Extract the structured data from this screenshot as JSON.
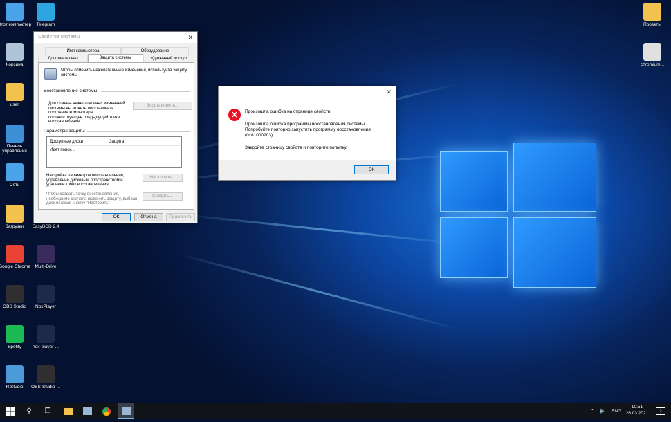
{
  "desktop": {
    "icons_left": [
      {
        "label": "Этот компьютер",
        "icon": "computer-icon",
        "color": "#4aa3e8"
      },
      {
        "label": "Telegram",
        "icon": "telegram-icon",
        "color": "#2ca5e0"
      },
      {
        "label": "Корзина",
        "icon": "recycle-bin-icon",
        "color": "#b0c4d8"
      },
      {
        "label": "user",
        "icon": "user-folder-icon",
        "color": "#f2c14e"
      },
      {
        "label": "Панель управления",
        "icon": "control-panel-icon",
        "color": "#3d8fd6"
      },
      {
        "label": "Сеть",
        "icon": "network-icon",
        "color": "#4aa3e8"
      },
      {
        "label": "Загрузки",
        "icon": "downloads-folder-icon",
        "color": "#f2c14e"
      },
      {
        "label": "EasyBCD 2.4",
        "icon": "easybcd-icon",
        "color": "#2d6cb5"
      },
      {
        "label": "Google Chrome",
        "icon": "chrome-icon",
        "color": "#ea4335"
      },
      {
        "label": "Multi-Drive",
        "icon": "nox-icon",
        "color": "#3a2b5e"
      },
      {
        "label": "OBS Studio",
        "icon": "obs-icon",
        "color": "#302e31"
      },
      {
        "label": "NoxPlayer",
        "icon": "nox-icon",
        "color": "#1d2a4a"
      },
      {
        "label": "Spotify",
        "icon": "spotify-icon",
        "color": "#1db954"
      },
      {
        "label": "nox-player-...",
        "icon": "nox-icon",
        "color": "#1d2a4a"
      },
      {
        "label": "R.Studio",
        "icon": "rstudio-icon",
        "color": "#4a9bd8"
      },
      {
        "label": "OBS-Studio-...",
        "icon": "obs-icon",
        "color": "#302e31"
      }
    ],
    "icons_right": [
      {
        "label": "Проекты",
        "icon": "folder-icon",
        "color": "#f2c14e"
      },
      {
        "label": "chromium...",
        "icon": "chromium-installer-icon",
        "color": "#e0e0e0"
      }
    ]
  },
  "system_properties": {
    "title": "Свойства системы",
    "tabs_row1": [
      "Имя компьютера",
      "Оборудование"
    ],
    "tabs_row2": [
      "Дополнительно",
      "Защита системы",
      "Удаленный доступ"
    ],
    "intro": "Чтобы отменить нежелательные изменения, используйте защиту системы",
    "restore_group": "Восстановление системы",
    "restore_desc": "Для отмены нежелательных изменений системы вы можете восстановить состояние компьютера, соответствующее предыдущей точке восстановления.",
    "restore_button": "Восстановить...",
    "protection_group": "Параметры защиты",
    "col_drives": "Доступные диски",
    "col_protection": "Защита",
    "searching": "Идет поиск...",
    "configure_desc": "Настройка параметров восстановления, управление дисковым пространством и удаление точек восстановления.",
    "configure_button": "Настроить...",
    "create_desc": "Чтобы создать точку восстановления, необходимо сначала включить защиту, выбрав диск и нажав кнопку \"Настроить\"",
    "create_button": "Создать...",
    "ok": "ОК",
    "cancel": "Отмена",
    "apply": "Применить"
  },
  "error_dialog": {
    "heading": "Произошла ошибка на странице свойств:",
    "line1": "Произошла ошибка программы восстановления системы.",
    "line2": "Попробуйте повторно запустить программу восстановления.",
    "code": "(0x81000203)",
    "line3": "Закройте страницу свойств и повторите попытку.",
    "ok": "ОК"
  },
  "taskbar": {
    "language": "ENG",
    "time": "10:51",
    "date": "26.03.2021",
    "notifications": "2"
  }
}
